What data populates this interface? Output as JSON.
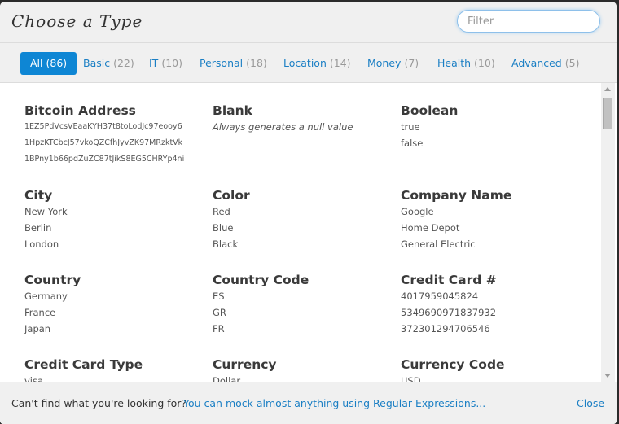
{
  "header": {
    "title": "Choose a Type",
    "filter_placeholder": "Filter",
    "filter_value": ""
  },
  "tabs": [
    {
      "label": "All",
      "count": "(86)",
      "active": true
    },
    {
      "label": "Basic",
      "count": "(22)",
      "active": false
    },
    {
      "label": "IT",
      "count": "(10)",
      "active": false
    },
    {
      "label": "Personal",
      "count": "(18)",
      "active": false
    },
    {
      "label": "Location",
      "count": "(14)",
      "active": false
    },
    {
      "label": "Money",
      "count": "(7)",
      "active": false
    },
    {
      "label": "Health",
      "count": "(10)",
      "active": false
    },
    {
      "label": "Advanced",
      "count": "(5)",
      "active": false
    }
  ],
  "types": [
    {
      "name": "Bitcoin Address",
      "examples": [
        "1EZ5PdVcsVEaaKYH37t8toLodJc97eooy6",
        "1HpzKTCbcJ57vkoQZCfhJyvZK97MRzktVk",
        "1BPny1b66pdZuZC87tJikS8EG5CHRYp4ni"
      ]
    },
    {
      "name": "Blank",
      "examples": [
        "Always generates a null value"
      ]
    },
    {
      "name": "Boolean",
      "examples": [
        "true",
        "false"
      ]
    },
    {
      "name": "City",
      "examples": [
        "New York",
        "Berlin",
        "London"
      ]
    },
    {
      "name": "Color",
      "examples": [
        "Red",
        "Blue",
        "Black"
      ]
    },
    {
      "name": "Company Name",
      "examples": [
        "Google",
        "Home Depot",
        "General Electric"
      ]
    },
    {
      "name": "Country",
      "examples": [
        "Germany",
        "France",
        "Japan"
      ]
    },
    {
      "name": "Country Code",
      "examples": [
        "ES",
        "GR",
        "FR"
      ]
    },
    {
      "name": "Credit Card #",
      "examples": [
        "4017959045824",
        "5349690971837932",
        "372301294706546"
      ]
    },
    {
      "name": "Credit Card Type",
      "examples": [
        "visa"
      ]
    },
    {
      "name": "Currency",
      "examples": [
        "Dollar"
      ]
    },
    {
      "name": "Currency Code",
      "examples": [
        "USD"
      ]
    }
  ],
  "footer": {
    "question": "Can't find what you're looking for?",
    "link": "You can mock almost anything using Regular Expressions...",
    "close": "Close"
  },
  "colors": {
    "accent": "#0e86d4",
    "link": "#1b7fc4"
  }
}
